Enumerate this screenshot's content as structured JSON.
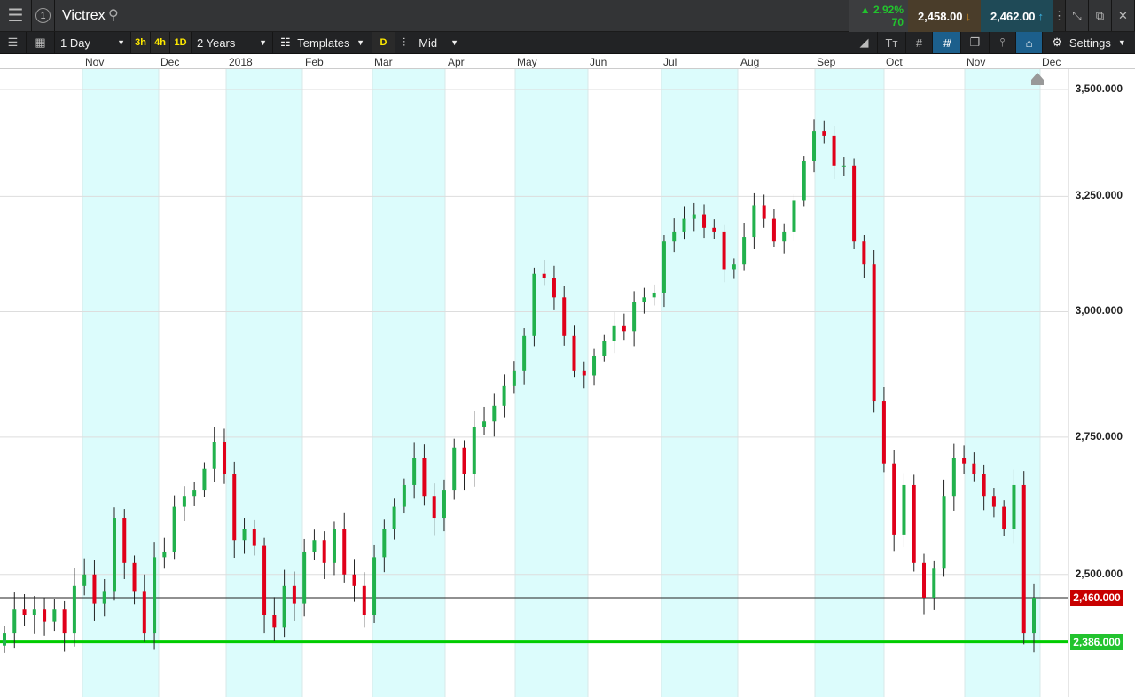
{
  "header": {
    "instrument": "Victrex",
    "change_pct": "▲ 2.92%",
    "change_pts": "70",
    "sell_price": "2,458.00",
    "buy_price": "2,462.00"
  },
  "toolbar": {
    "interval": "1 Day",
    "quick": [
      "3h",
      "4h",
      "1D"
    ],
    "range": "2 Years",
    "templates": "Templates",
    "d": "D",
    "price_type": "Mid",
    "settings": "Settings"
  },
  "colors": {
    "up": "#22b14c",
    "down": "#e0001a",
    "shade": "#dcfcfc",
    "support": "#00cc00",
    "current": "#c80000"
  },
  "chart_data": {
    "type": "candlestick",
    "title": "Victrex",
    "scale": "log",
    "ylim": [
      2320,
      3580
    ],
    "yticks": [
      "3,500.000",
      "3,250.000",
      "3,000.000",
      "2,750.000",
      "2,500.000"
    ],
    "ytick_values": [
      3500,
      3250,
      3000,
      2750,
      2500
    ],
    "months": [
      "Nov",
      "Dec",
      "2018",
      "Feb",
      "Mar",
      "Apr",
      "May",
      "Jun",
      "Jul",
      "Aug",
      "Sep",
      "Oct",
      "Nov",
      "Dec"
    ],
    "current_price": {
      "label": "2,460.000",
      "value": 2460
    },
    "support_line": {
      "label": "2,386.000",
      "value": 2386
    },
    "closes": [
      2400,
      2440,
      2430,
      2440,
      2420,
      2440,
      2400,
      2480,
      2500,
      2450,
      2470,
      2600,
      2520,
      2470,
      2400,
      2530,
      2540,
      2620,
      2640,
      2650,
      2690,
      2740,
      2680,
      2560,
      2580,
      2550,
      2430,
      2410,
      2480,
      2450,
      2540,
      2560,
      2520,
      2580,
      2500,
      2480,
      2430,
      2530,
      2580,
      2620,
      2660,
      2710,
      2640,
      2600,
      2650,
      2730,
      2680,
      2770,
      2780,
      2810,
      2850,
      2880,
      2950,
      3080,
      3070,
      3030,
      2950,
      2880,
      2870,
      2910,
      2940,
      2970,
      2960,
      3020,
      3030,
      3040,
      3150,
      3170,
      3200,
      3210,
      3180,
      3170,
      3090,
      3100,
      3160,
      3230,
      3200,
      3150,
      3170,
      3240,
      3330,
      3400,
      3390,
      3320,
      3320,
      3150,
      3100,
      2820,
      2700,
      2570,
      2660,
      2520,
      2460,
      2510,
      2640,
      2710,
      2700,
      2680,
      2640,
      2620,
      2580,
      2660,
      2400,
      2460
    ]
  }
}
